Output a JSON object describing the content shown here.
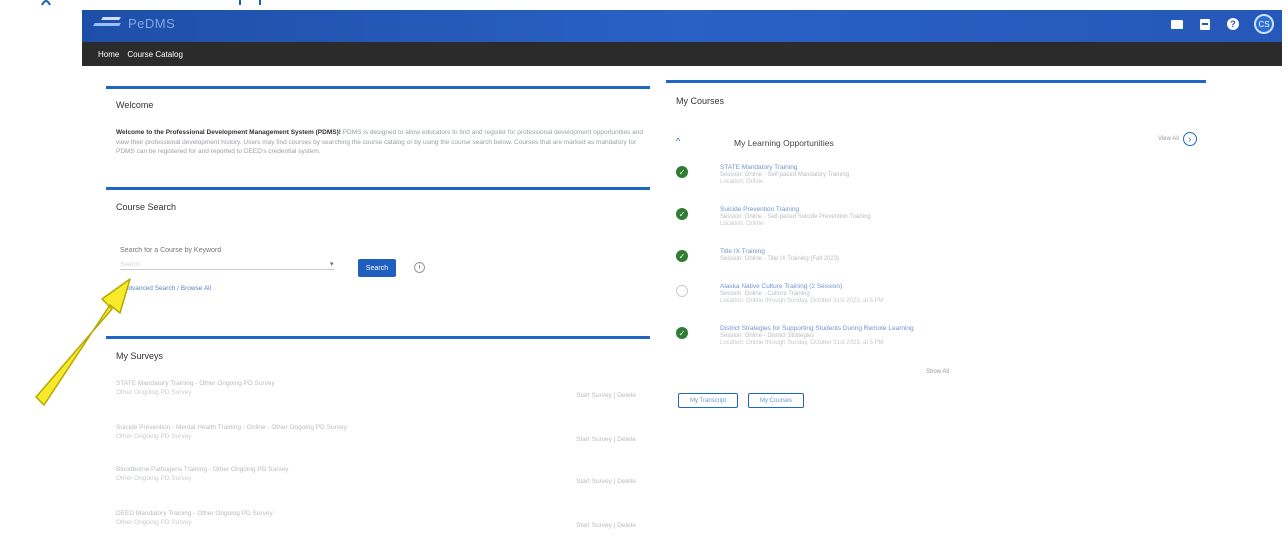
{
  "header": {
    "logo_text": "PeDMS",
    "avatar_initials": "CS"
  },
  "nav": {
    "items": [
      "Home",
      "Course Catalog"
    ]
  },
  "welcome": {
    "title": "Welcome",
    "intro_bold": "Welcome to the Professional Development Management System (PDMS)!",
    "body": "PDMS is designed to allow educators to find and register for professional development opportunities and view their professional development history. Users may find courses by searching the course catalog or by using the course search below. Courses that are marked as mandatory for PDMS can be registered for and reported to DEED's credential system."
  },
  "course_search": {
    "title": "Course Search",
    "search_placeholder": "Search for a Course by Keyword",
    "select_label": "Search",
    "select_value": "",
    "search_button": "Search",
    "info_label": "i",
    "advanced_link": "Advanced Search / Browse All"
  },
  "surveys": {
    "title": "My Surveys",
    "items": [
      {
        "line1": "STATE Mandatory Training - Other Ongoing PD Survey",
        "line2": "Other Ongoing PD Survey",
        "action": "Start Survey | Delete"
      },
      {
        "line1": "Suicide Prevention - Mental Health Training - Online - Other Ongoing PD Survey",
        "line2": "Other Ongoing PD Survey",
        "action": "Start Survey | Delete"
      },
      {
        "line1": "Bloodborne Pathogens Training - Other Ongoing PD Survey",
        "line2": "Other Ongoing PD Survey",
        "action": "Start Survey | Delete"
      },
      {
        "line1": "DEED Mandatory Training - Other Ongoing PD Survey",
        "line2": "Other Ongoing PD Survey",
        "action": "Start Survey | Delete"
      }
    ]
  },
  "my_courses": {
    "title": "My Courses",
    "section_title": "My Learning Opportunities",
    "view_all": "View All",
    "show_more": "Show All",
    "items": [
      {
        "status": "complete",
        "title": "STATE Mandatory Training",
        "meta": "Session: Online - Self-paced Mandatory Training",
        "extra": "Location: Online"
      },
      {
        "status": "complete",
        "title": "Suicide Prevention Training",
        "meta": "Session: Online - Self-paced Suicide Prevention Training",
        "extra": "Location: Online"
      },
      {
        "status": "complete",
        "title": "Title IX Training",
        "meta": "Session: Online - Title IX Training (Fall 2023)",
        "extra": ""
      },
      {
        "status": "pending",
        "title": "Alaska Native Culture Training (2 Session)",
        "meta": "Session: Online - Culture Training",
        "extra": "Location: Online through Sunday, October 31st 2023, at 5 PM"
      },
      {
        "status": "complete",
        "title": "District Strategies for Supporting Students During Remote Learning",
        "meta": "Session: Online - District Strategies",
        "extra": "Location: Online through Sunday, October 31st 2023, at 5 PM"
      }
    ],
    "buttons": [
      "My Transcript",
      "My Courses"
    ]
  }
}
